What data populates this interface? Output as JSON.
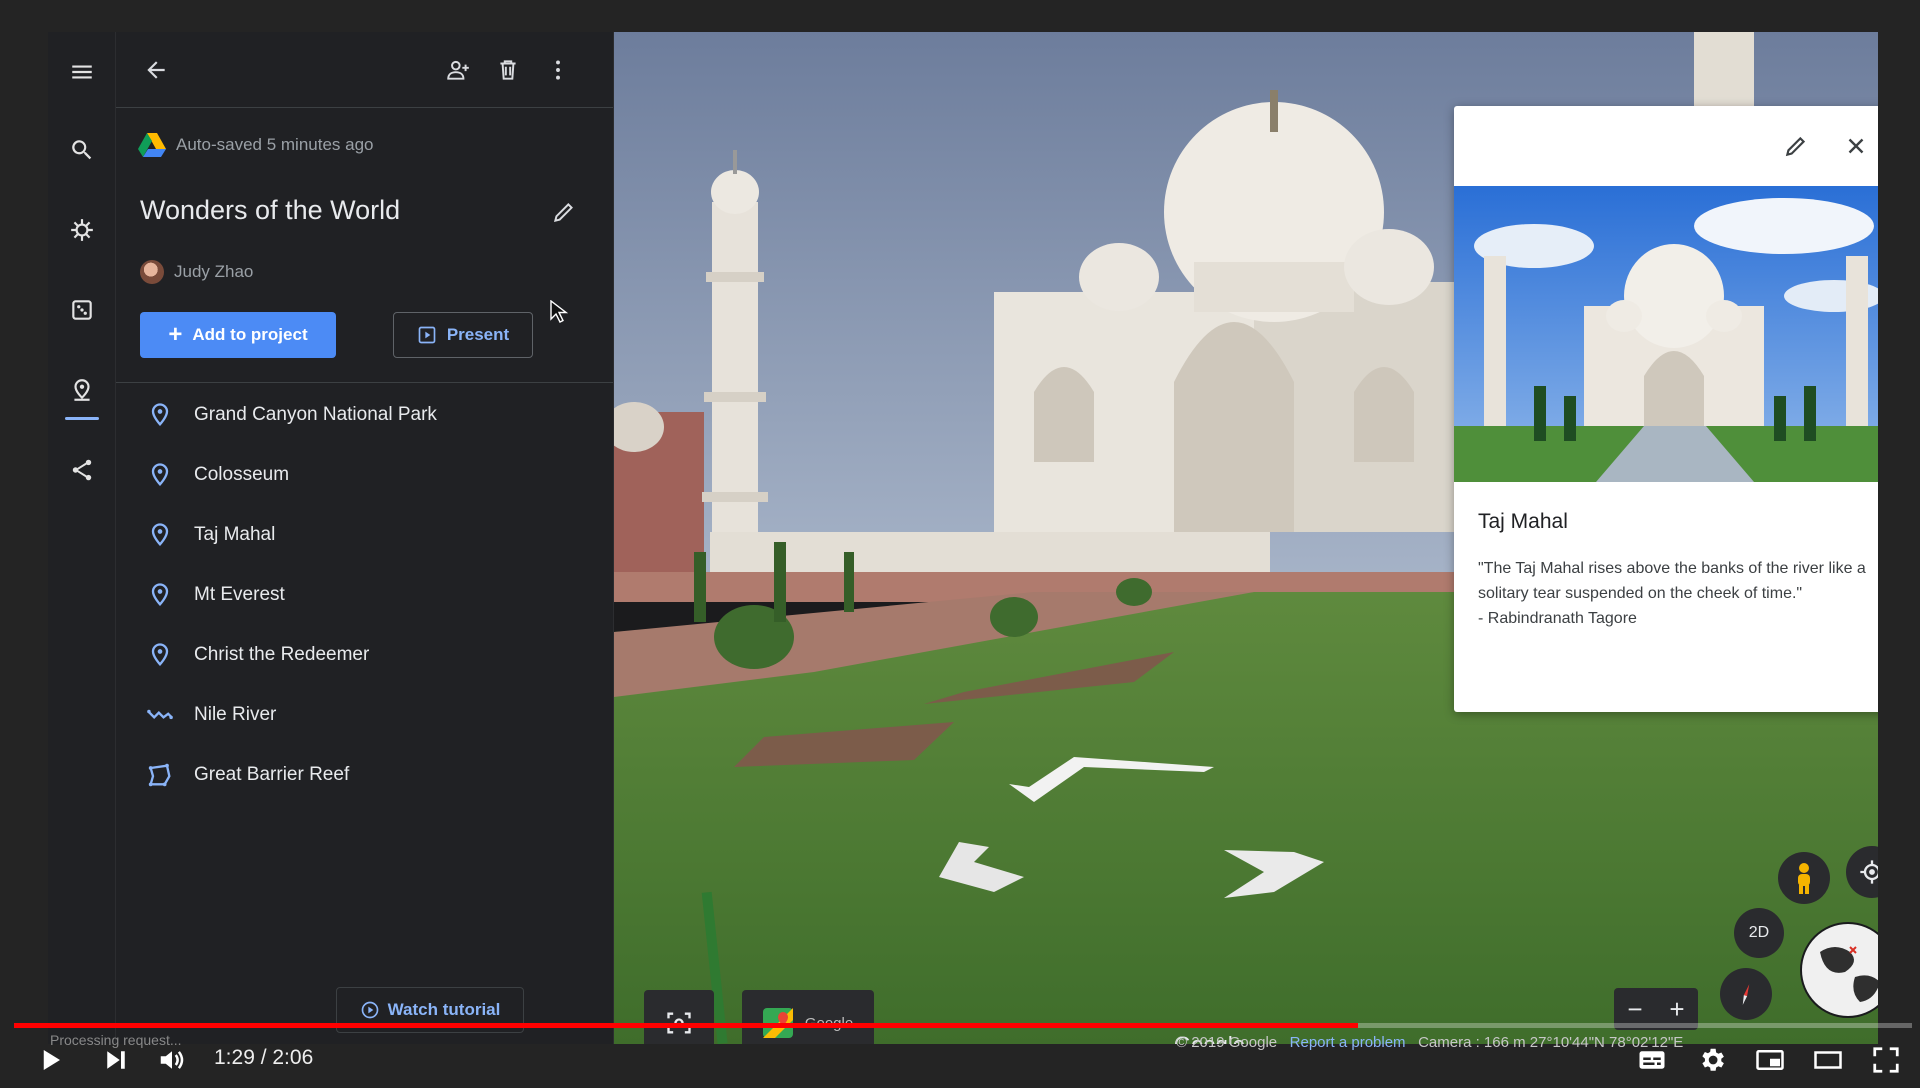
{
  "project": {
    "autosave": "Auto-saved 5 minutes ago",
    "title": "Wonders of the World",
    "owner": "Judy Zhao",
    "add_label": "Add to project",
    "present_label": "Present",
    "watch_tutorial": "Watch tutorial",
    "places": [
      {
        "name": "Grand Canyon National Park",
        "icon": "place-marker-icon"
      },
      {
        "name": "Colosseum",
        "icon": "place-marker-icon"
      },
      {
        "name": "Taj Mahal",
        "icon": "place-marker-icon"
      },
      {
        "name": "Mt Everest",
        "icon": "place-marker-icon"
      },
      {
        "name": "Christ the Redeemer",
        "icon": "place-marker-icon"
      },
      {
        "name": "Nile River",
        "icon": "line-path-icon"
      },
      {
        "name": "Great Barrier Reef",
        "icon": "polygon-icon"
      }
    ]
  },
  "card": {
    "title": "Taj Mahal",
    "quote": "\"The Taj Mahal rises above the banks of the river like a solitary tear suspended on the cheek of time.\"",
    "cite": "- Rabindranath Tagore"
  },
  "map": {
    "mode_2d": "2D",
    "google_chip": "Google",
    "watermark": "Google",
    "copyright": "© 2019 Google",
    "report": "Report a problem",
    "camera": "Camera :  166 m   27°10'44\"N 78°02'12\"E"
  },
  "player": {
    "status": "Processing request...",
    "time": "1:29 / 2:06",
    "progress": 0.708
  },
  "colors": {
    "accent": "#8ab4f8",
    "primary_button": "#4c8bf5",
    "progress_red": "#ff0000",
    "panel_bg": "#202124"
  }
}
